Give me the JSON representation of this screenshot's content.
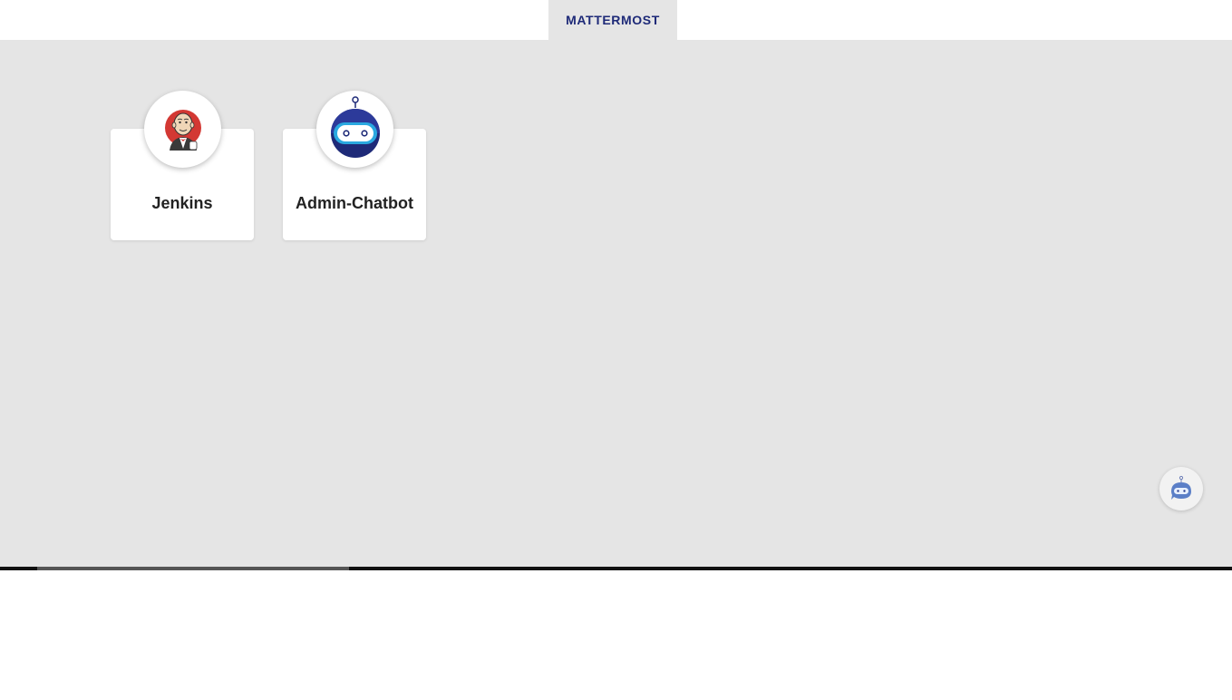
{
  "header": {
    "tab_label": "MATTERMOST",
    "tab_color": "#1e2a78"
  },
  "apps": [
    {
      "label": "Jenkins",
      "icon": "jenkins-butler-icon"
    },
    {
      "label": "Admin-Chatbot",
      "icon": "robot-head-icon"
    }
  ],
  "chat_fab": {
    "icon": "chatbot-icon"
  },
  "colors": {
    "background": "#e5e5e5",
    "card": "#ffffff",
    "robot_navy": "#1e2a78",
    "robot_cyan": "#2aa8e0",
    "jenkins_red": "#d33833"
  }
}
